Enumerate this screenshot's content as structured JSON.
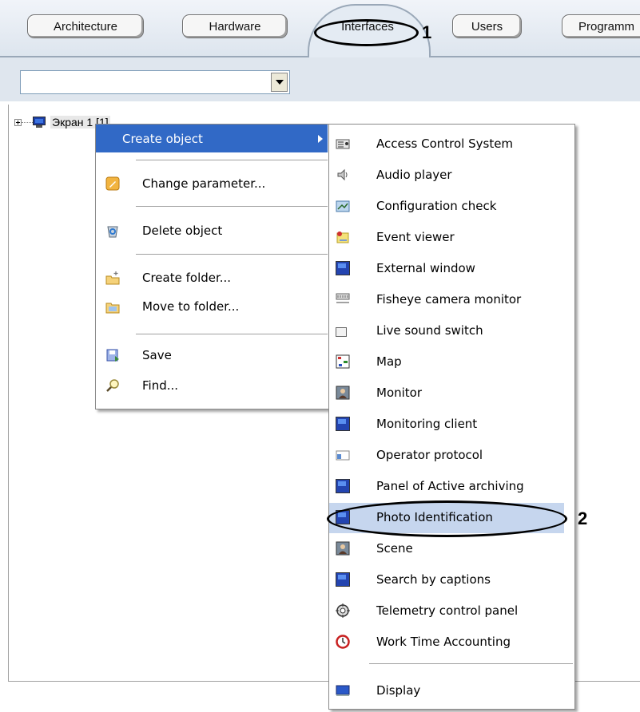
{
  "tabs": {
    "architecture": "Architecture",
    "hardware": "Hardware",
    "interfaces": "Interfaces",
    "users": "Users",
    "programming": "Programm"
  },
  "callouts": {
    "one": "1",
    "two": "2"
  },
  "tree": {
    "node_label": "Экран 1 [1]"
  },
  "context_menu": {
    "items": [
      {
        "label": "Create object",
        "icon": "none",
        "submenu": true
      },
      {
        "label": "Change parameter...",
        "icon": "pencil-icon"
      },
      {
        "label": "Delete object",
        "icon": "recycle-bin-icon"
      },
      {
        "label": "Create folder...",
        "icon": "new-folder-icon"
      },
      {
        "label": "Move to folder...",
        "icon": "move-folder-icon"
      },
      {
        "label": "Save",
        "icon": "save-icon"
      },
      {
        "label": "Find...",
        "icon": "magnifier-icon"
      }
    ]
  },
  "create_submenu": {
    "items": [
      {
        "label": "Access Control System",
        "icon": "access-control-icon"
      },
      {
        "label": "Audio player",
        "icon": "speaker-icon"
      },
      {
        "label": "Configuration check",
        "icon": "config-check-icon"
      },
      {
        "label": "Event viewer",
        "icon": "event-viewer-icon"
      },
      {
        "label": "External window",
        "icon": "window-icon"
      },
      {
        "label": "Fisheye camera monitor",
        "icon": "fisheye-icon"
      },
      {
        "label": "Live sound switch",
        "icon": "sound-switch-icon"
      },
      {
        "label": "Map",
        "icon": "map-icon"
      },
      {
        "label": "Monitor",
        "icon": "monitor-icon"
      },
      {
        "label": "Monitoring client",
        "icon": "window-icon"
      },
      {
        "label": "Operator protocol",
        "icon": "protocol-icon"
      },
      {
        "label": "Panel of Active archiving",
        "icon": "window-icon"
      },
      {
        "label": "Photo Identification",
        "icon": "window-icon",
        "highlighted": true
      },
      {
        "label": "Scene",
        "icon": "scene-icon"
      },
      {
        "label": "Search by captions",
        "icon": "window-icon"
      },
      {
        "label": "Telemetry control panel",
        "icon": "telemetry-icon"
      },
      {
        "label": "Work Time Accounting",
        "icon": "clock-icon"
      },
      {
        "label": "Display",
        "icon": "display-icon"
      }
    ]
  },
  "colors": {
    "menu_highlight": "#3169c6",
    "hover_item": "#c6d6ee"
  }
}
